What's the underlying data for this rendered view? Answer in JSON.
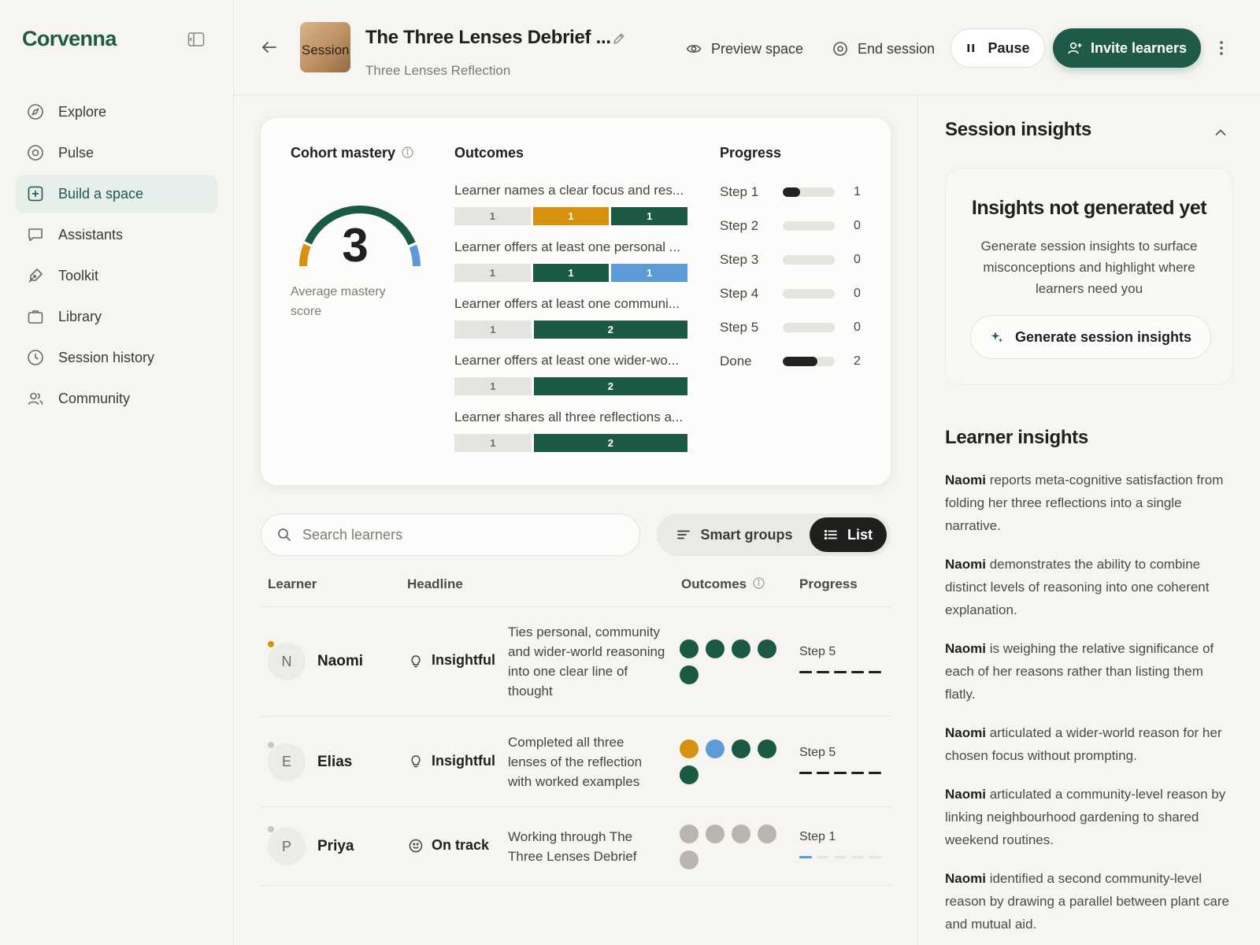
{
  "app": {
    "logo": "Corvenna"
  },
  "sidebar": {
    "items": [
      {
        "label": "Explore",
        "icon": "compass-icon"
      },
      {
        "label": "Pulse",
        "icon": "pulse-icon"
      },
      {
        "label": "Build a space",
        "icon": "plus-square-icon",
        "active": true
      },
      {
        "label": "Assistants",
        "icon": "chat-icon"
      },
      {
        "label": "Toolkit",
        "icon": "pen-tool-icon"
      },
      {
        "label": "Library",
        "icon": "briefcase-icon"
      },
      {
        "label": "Session history",
        "icon": "clock-icon"
      },
      {
        "label": "Community",
        "icon": "users-icon"
      }
    ]
  },
  "header": {
    "cover_alt": "Session cover:",
    "title": "The Three Lenses Debrief ...",
    "subtitle": "Three Lenses Reflection",
    "preview_label": "Preview space",
    "end_label": "End session",
    "pause_label": "Pause",
    "invite_label": "Invite learners"
  },
  "card": {
    "mastery_title": "Cohort mastery",
    "mastery_value": "3",
    "mastery_value_fraction": 0.6,
    "mastery_caption": "Average mastery score",
    "outcomes_title": "Outcomes",
    "outcomes": [
      {
        "label": "Learner names a clear focus and res...",
        "segments": [
          {
            "value": 1,
            "color": "grey",
            "text": "1"
          },
          {
            "value": 1,
            "color": "amber",
            "text": "1"
          },
          {
            "value": 1,
            "color": "green",
            "text": "1"
          }
        ]
      },
      {
        "label": "Learner offers at least one personal ...",
        "segments": [
          {
            "value": 1,
            "color": "grey",
            "text": "1"
          },
          {
            "value": 1,
            "color": "green",
            "text": "1"
          },
          {
            "value": 1,
            "color": "blue",
            "text": "1"
          }
        ]
      },
      {
        "label": "Learner offers at least one communi...",
        "segments": [
          {
            "value": 1,
            "color": "grey",
            "text": "1"
          },
          {
            "value": 2,
            "color": "green",
            "text": "2"
          }
        ]
      },
      {
        "label": "Learner offers at least one wider-wo...",
        "segments": [
          {
            "value": 1,
            "color": "grey",
            "text": "1"
          },
          {
            "value": 2,
            "color": "green",
            "text": "2"
          }
        ]
      },
      {
        "label": "Learner shares all three reflections a...",
        "segments": [
          {
            "value": 1,
            "color": "grey",
            "text": "1"
          },
          {
            "value": 2,
            "color": "green",
            "text": "2"
          }
        ]
      }
    ],
    "progress_title": "Progress",
    "progress": [
      {
        "label": "Step 1",
        "count": "1",
        "fraction": 0.33
      },
      {
        "label": "Step 2",
        "count": "0",
        "fraction": 0
      },
      {
        "label": "Step 3",
        "count": "0",
        "fraction": 0
      },
      {
        "label": "Step 4",
        "count": "0",
        "fraction": 0
      },
      {
        "label": "Step 5",
        "count": "0",
        "fraction": 0
      },
      {
        "label": "Done",
        "count": "2",
        "fraction": 0.67
      }
    ]
  },
  "search": {
    "placeholder": "Search learners"
  },
  "view_toggle": {
    "smart_label": "Smart groups",
    "list_label": "List",
    "selected": "List"
  },
  "table": {
    "headers": {
      "learner": "Learner",
      "headline": "Headline",
      "outcomes": "Outcomes",
      "progress": "Progress"
    },
    "rows": [
      {
        "initial": "N",
        "name": "Naomi",
        "status_color": "#d8900f",
        "badge": "Insightful",
        "badge_icon": "lightbulb-icon",
        "description": "Ties personal, community and wider-world reasoning into one clear line of thought",
        "dots": [
          "#1a5a45",
          "#1a5a45",
          "#1a5a45",
          "#1a5a45",
          "#1a5a45"
        ],
        "step": "Step 5",
        "steps_done": 5
      },
      {
        "initial": "E",
        "name": "Elias",
        "status_color": "#c8c7c2",
        "badge": "Insightful",
        "badge_icon": "lightbulb-icon",
        "description": "Completed all three lenses of the reflection with worked examples",
        "dots": [
          "#d8900f",
          "#5b9bd8",
          "#1a5a45",
          "#1a5a45",
          "#1a5a45"
        ],
        "step": "Step 5",
        "steps_done": 5
      },
      {
        "initial": "P",
        "name": "Priya",
        "status_color": "#c8c7c2",
        "badge": "On track",
        "badge_icon": "smile-icon",
        "description": "Working through The Three Lenses Debrief",
        "dots": [
          "#b8b5ae",
          "#b8b5ae",
          "#b8b5ae",
          "#b8b5ae",
          "#b8b5ae"
        ],
        "step": "Step 1",
        "steps_done": 1
      }
    ]
  },
  "insights": {
    "title": "Session insights",
    "empty_title": "Insights not generated yet",
    "empty_text": "Generate session insights to surface misconceptions and highlight where learners need you",
    "generate_label": "Generate session insights",
    "learner_title": "Learner insights",
    "learner_items": [
      {
        "name": "Naomi",
        "text": " reports meta-cognitive satisfaction from folding her three reflections into a single narrative."
      },
      {
        "name": "Naomi",
        "text": " demonstrates the ability to combine distinct levels of reasoning into one coherent explanation."
      },
      {
        "name": "Naomi",
        "text": " is weighing the relative significance of each of her reasons rather than listing them flatly."
      },
      {
        "name": "Naomi",
        "text": " articulated a wider-world reason for her chosen focus without prompting."
      },
      {
        "name": "Naomi",
        "text": " articulated a community-level reason by linking neighbourhood gardening to shared weekend routines."
      },
      {
        "name": "Naomi",
        "text": " identified a second community-level reason by drawing a parallel between plant care and mutual aid."
      }
    ]
  },
  "colors": {
    "brand": "#1e5a47",
    "amber": "#d8900f",
    "blue": "#5b9bd8",
    "grey": "#e6e4df",
    "dark": "#1f1f1d"
  }
}
